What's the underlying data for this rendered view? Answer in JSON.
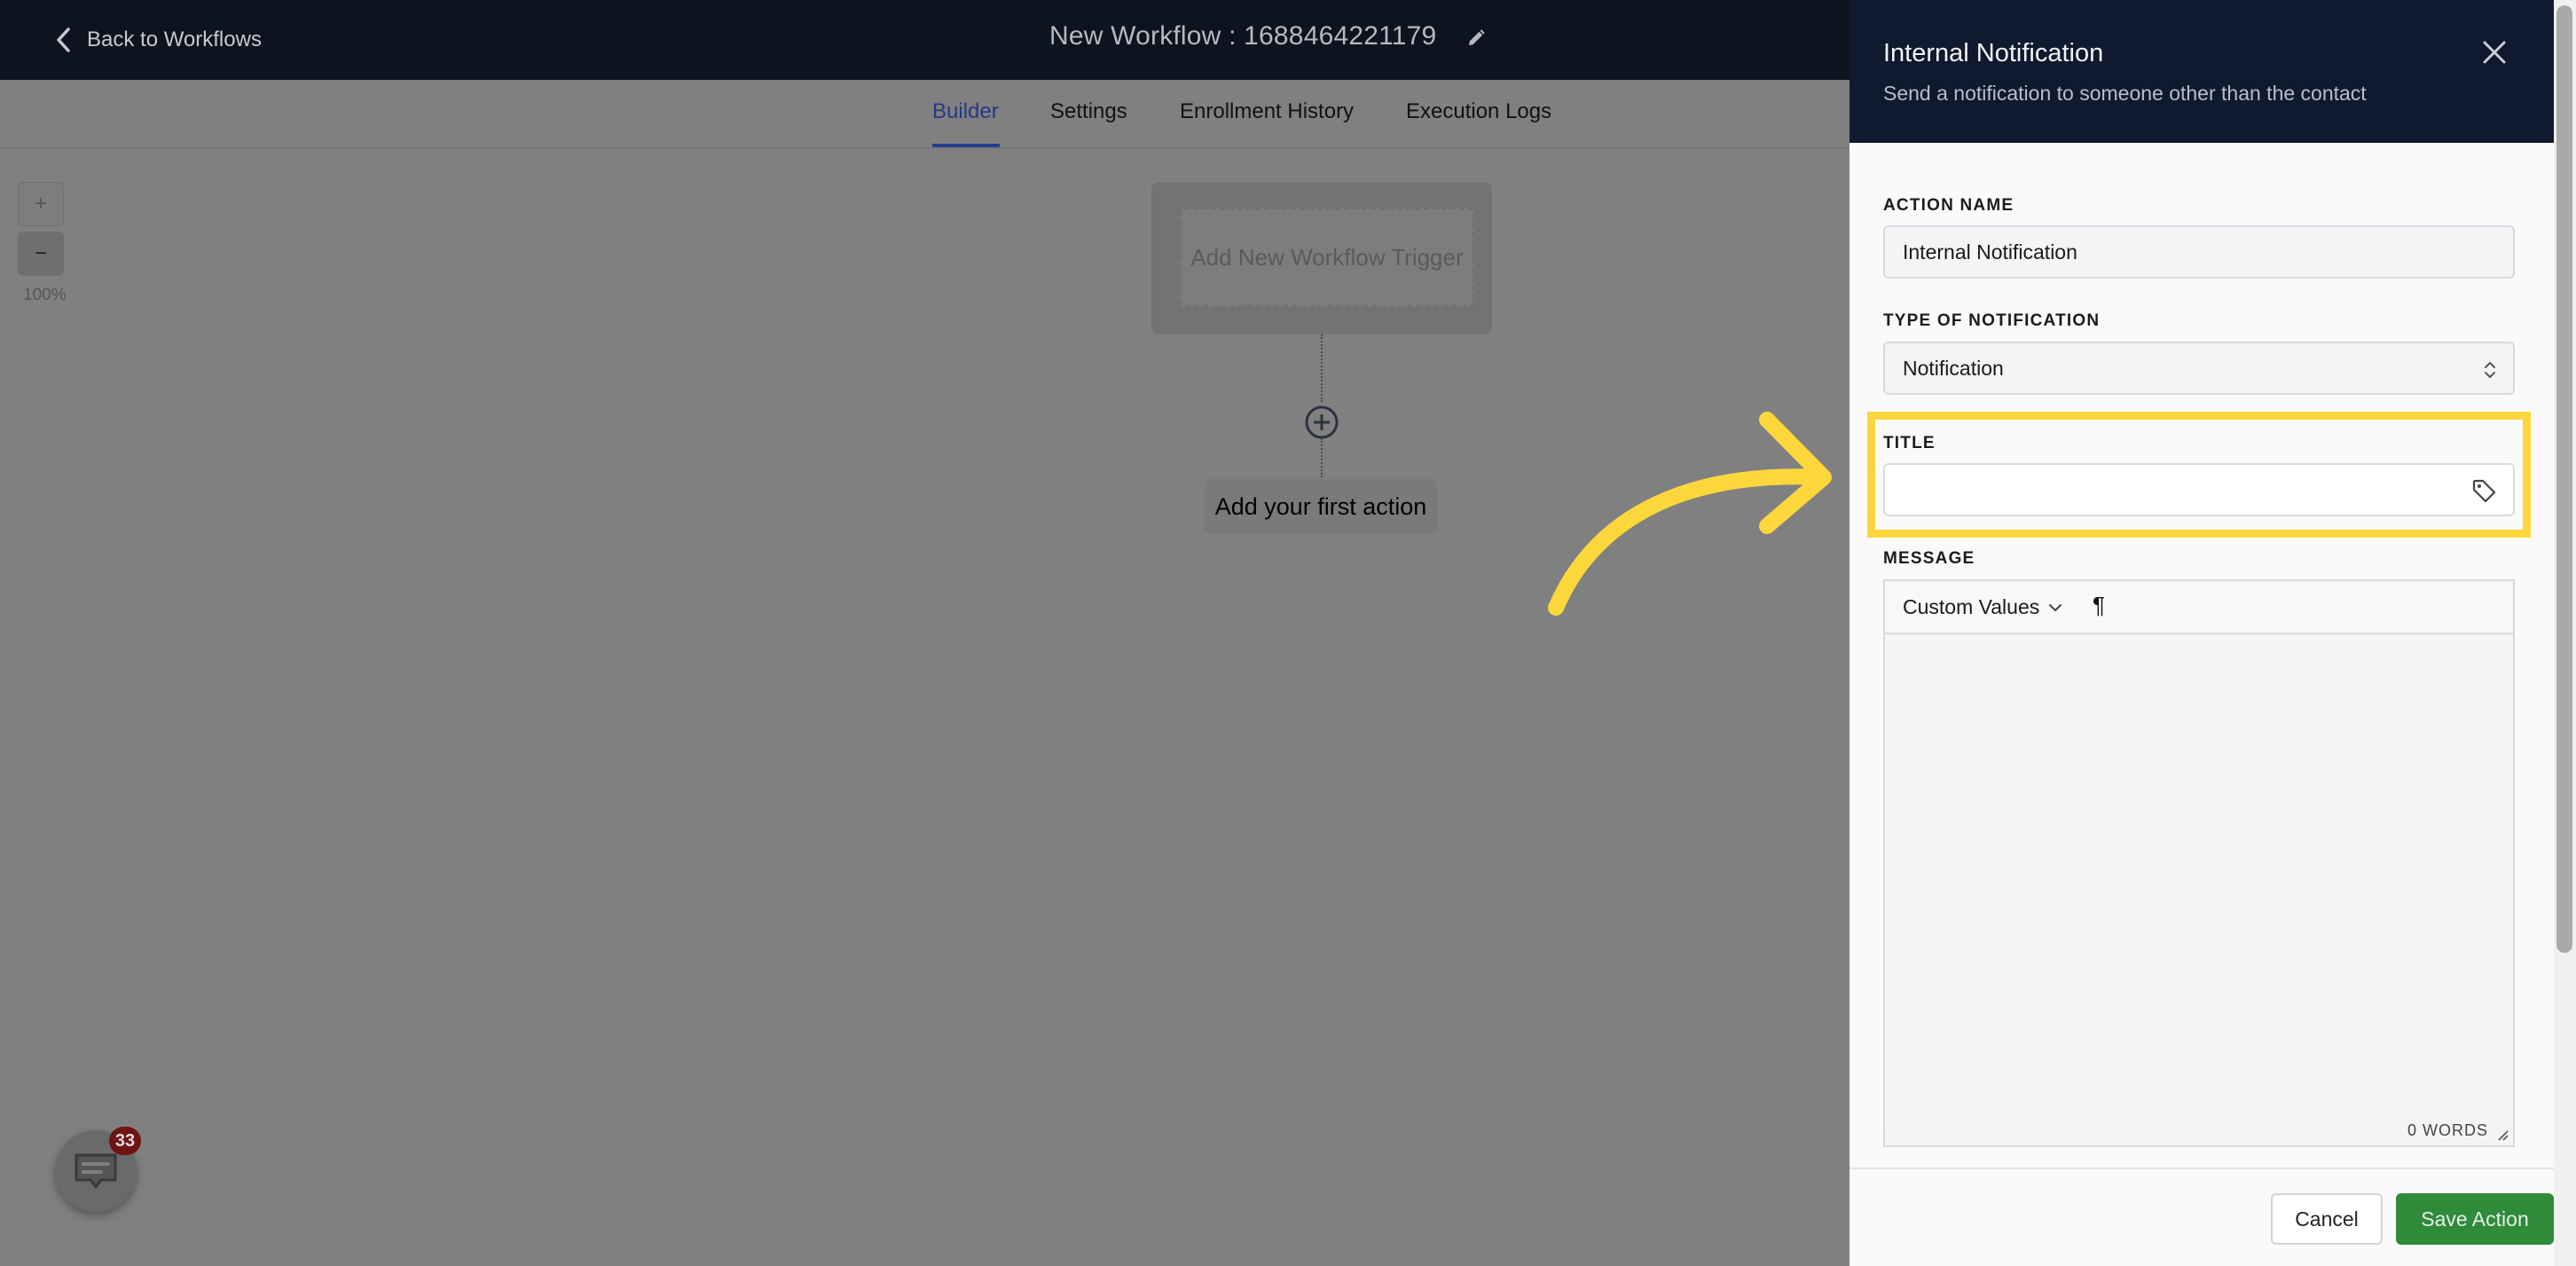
{
  "topbar": {
    "back_label": "Back to Workflows",
    "workflow_title": "New Workflow : 1688464221179"
  },
  "tabs": [
    {
      "label": "Builder",
      "active": true
    },
    {
      "label": "Settings"
    },
    {
      "label": "Enrollment History"
    },
    {
      "label": "Execution Logs"
    }
  ],
  "canvas": {
    "zoom_in": "+",
    "zoom_out": "−",
    "zoom_level": "100%",
    "trigger_label": "Add New Workflow Trigger",
    "first_action_label": "Add your first action"
  },
  "chat_widget": {
    "badge_count": "33"
  },
  "panel": {
    "title": "Internal Notification",
    "subtitle": "Send a notification to someone other than the contact",
    "action_name_label": "ACTION NAME",
    "action_name_value": "Internal Notification",
    "type_label": "TYPE OF NOTIFICATION",
    "type_value": "Notification",
    "title_label": "TITLE",
    "title_value": "",
    "message_label": "MESSAGE",
    "custom_values_label": "Custom Values",
    "pilcrow": "¶",
    "word_count": "0 WORDS",
    "cancel_label": "Cancel",
    "save_label": "Save Action"
  },
  "colors": {
    "highlight": "#fcd73c",
    "save_button": "#2f8a3a",
    "panel_header": "#0f1a2e",
    "active_tab": "#223a84"
  }
}
